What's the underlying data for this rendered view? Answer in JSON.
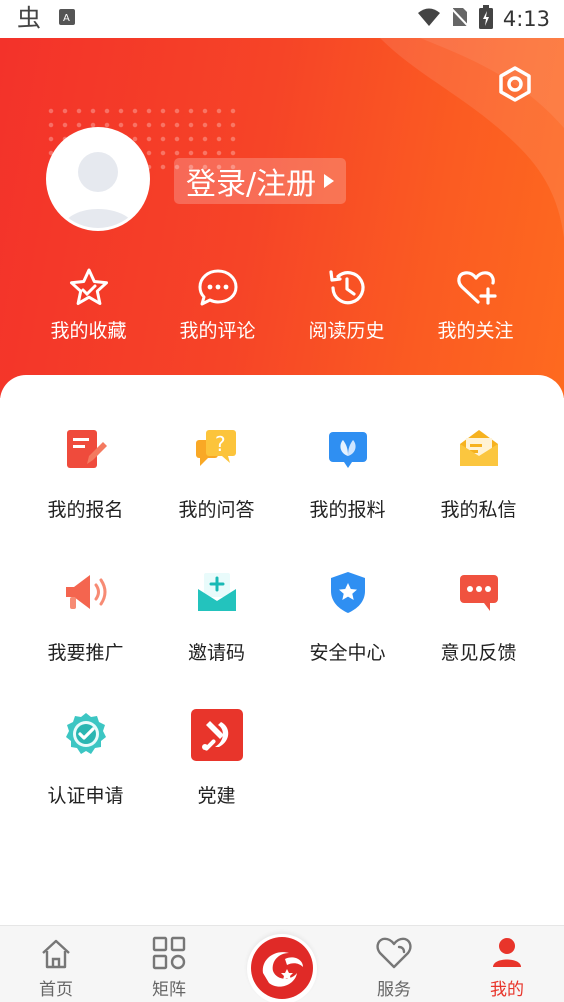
{
  "status_bar": {
    "time": "4:13"
  },
  "header": {
    "login_label": "登录/注册",
    "quick_actions": [
      {
        "label": "我的收藏",
        "icon": "star-icon"
      },
      {
        "label": "我的评论",
        "icon": "comment-icon"
      },
      {
        "label": "阅读历史",
        "icon": "history-icon"
      },
      {
        "label": "我的关注",
        "icon": "heart-plus-icon"
      }
    ]
  },
  "services": [
    {
      "label": "我的报名",
      "icon": "signup-icon"
    },
    {
      "label": "我的问答",
      "icon": "qa-icon"
    },
    {
      "label": "我的报料",
      "icon": "report-icon"
    },
    {
      "label": "我的私信",
      "icon": "message-icon"
    },
    {
      "label": "我要推广",
      "icon": "megaphone-icon"
    },
    {
      "label": "邀请码",
      "icon": "invite-icon"
    },
    {
      "label": "安全中心",
      "icon": "shield-icon"
    },
    {
      "label": "意见反馈",
      "icon": "feedback-icon"
    },
    {
      "label": "认证申请",
      "icon": "verified-icon"
    },
    {
      "label": "党建",
      "icon": "party-icon"
    }
  ],
  "tabbar": {
    "tabs": [
      {
        "label": "首页",
        "icon": "home-icon"
      },
      {
        "label": "矩阵",
        "icon": "grid-icon"
      },
      {
        "label": "服务",
        "icon": "heart-icon"
      },
      {
        "label": "我的",
        "icon": "user-icon",
        "active": true
      }
    ]
  },
  "colors": {
    "primary": "#f3322a",
    "accent": "#fe6a1f",
    "active_tab": "#e8342a"
  }
}
